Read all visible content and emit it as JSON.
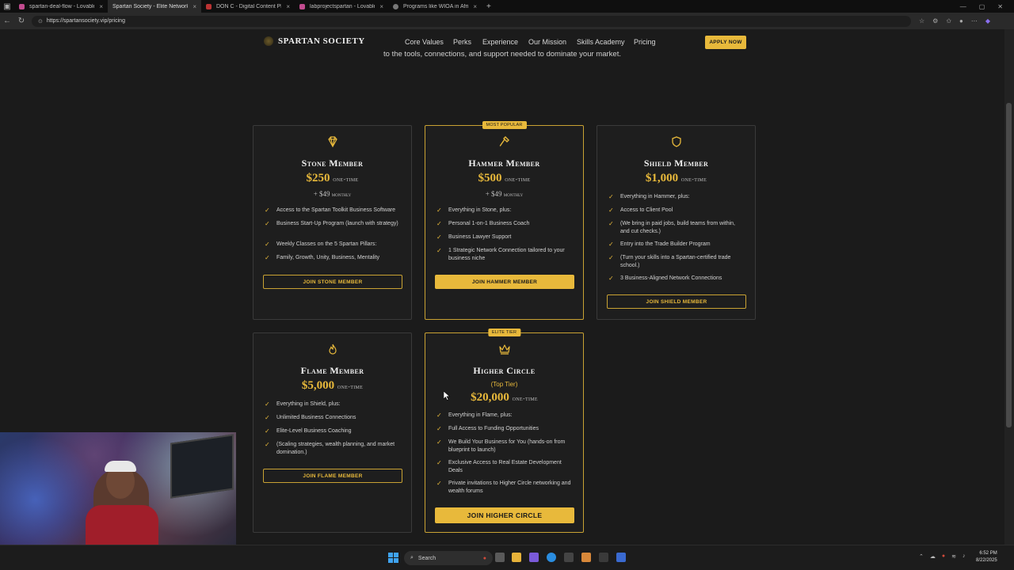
{
  "browser": {
    "tabs": [
      {
        "title": "spartan-deal-flow - Lovable"
      },
      {
        "title": "Spartan Society - Elite Networking"
      },
      {
        "title": "DON C - Digital Content Platform"
      },
      {
        "title": "labprojectspartan - Lovable"
      },
      {
        "title": "Programs like WIOA in Africa"
      }
    ],
    "url": "https://spartansociety.vip/pricing"
  },
  "site": {
    "logo": "SPARTAN SOCIETY",
    "nav": [
      "Core Values",
      "Perks",
      "Experience",
      "Our Mission",
      "Skills Academy",
      "Pricing"
    ],
    "apply": "APPLY NOW",
    "intro": "to the tools, connections, and support needed to dominate your market."
  },
  "cards": [
    {
      "title": "Stone Member",
      "price": "$250",
      "unit": "one-time",
      "sub": "+ $49",
      "sub_unit": "monthly",
      "features": [
        "Access to the Spartan Toolkit Business Software",
        "Business Start-Up Program (launch with strategy)",
        "Weekly Classes on the 5 Spartan Pillars:",
        "Family, Growth, Unity, Business, Mentality"
      ],
      "button": "JOIN STONE MEMBER"
    },
    {
      "badge": "MOST POPULAR",
      "title": "Hammer Member",
      "price": "$500",
      "unit": "one-time",
      "sub": "+ $49",
      "sub_unit": "monthly",
      "features": [
        "Everything in Stone, plus:",
        "Personal 1-on-1 Business Coach",
        "Business Lawyer Support",
        "1 Strategic Network Connection tailored to your business niche"
      ],
      "button": "JOIN HAMMER MEMBER"
    },
    {
      "title": "Shield Member",
      "price": "$1,000",
      "unit": "one-time",
      "features": [
        "Everything in Hammer, plus:",
        "Access to Client Pool",
        "(We bring in paid jobs, build teams from within, and cut checks.)",
        "Entry into the Trade Builder Program",
        "(Turn your skills into a Spartan-certified trade school.)",
        "3 Business-Aligned Network Connections"
      ],
      "button": "JOIN SHIELD MEMBER"
    },
    {
      "title": "Flame Member",
      "price": "$5,000",
      "unit": "one-time",
      "features": [
        "Everything in Shield, plus:",
        "Unlimited Business Connections",
        "Elite-Level Business Coaching",
        "(Scaling strategies, wealth planning, and market domination.)"
      ],
      "button": "JOIN FLAME MEMBER"
    },
    {
      "badge": "ELITE TIER",
      "title": "Higher Circle",
      "tagline": "(Top Tier)",
      "price": "$20,000",
      "unit": "one-time",
      "features": [
        "Everything in Flame, plus:",
        "Full Access to Funding Opportunities",
        "We Build Your Business for You (hands-on from blueprint to launch)",
        "Exclusive Access to Real Estate Development Deals",
        "Private invitations to Higher Circle networking and wealth forums"
      ],
      "button": "JOIN HIGHER CIRCLE"
    }
  ],
  "taskbar": {
    "search": "Search",
    "time": "6:52 PM",
    "date": "8/22/2025"
  },
  "colors": {
    "accent": "#e8b93b",
    "background": "#1b1b1b",
    "card_border": "#3a3a3a"
  }
}
